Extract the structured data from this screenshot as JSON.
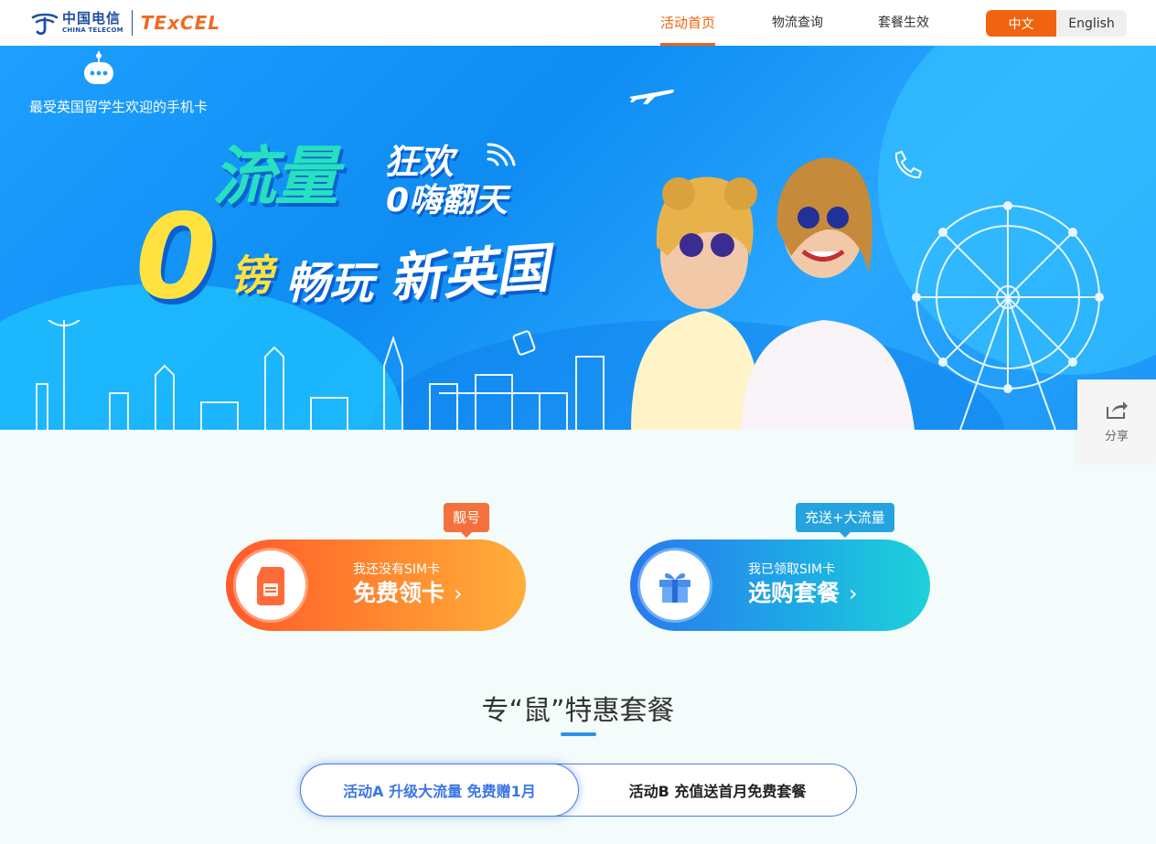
{
  "header": {
    "logo": {
      "cn_name": "中国电信",
      "en_name": "CHINA TELECOM",
      "brand": "TExCEL"
    },
    "nav": [
      {
        "label": "活动首页",
        "active": true
      },
      {
        "label": "物流查询",
        "active": false
      },
      {
        "label": "套餐生效",
        "active": false
      }
    ],
    "lang": {
      "zh": "中文",
      "en": "English",
      "active": "中文"
    }
  },
  "banner": {
    "tagline": "最受英国留学生欢迎的手机卡",
    "headline": {
      "flow": "流量",
      "carnival": "狂欢",
      "fun": "0嗨翻天",
      "zero": "0",
      "pound": "镑",
      "play": "畅玩",
      "uk": "新英国"
    }
  },
  "share": {
    "label": "分享",
    "icon": "share-icon"
  },
  "cta": {
    "new_sim": {
      "badge": "靓号",
      "subtitle": "我还没有SIM卡",
      "title": "免费领卡",
      "icon": "sim-card-icon",
      "color": "#ff6a2a"
    },
    "have_sim": {
      "badge": "充送+大流量",
      "subtitle": "我已领取SIM卡",
      "title": "选购套餐",
      "icon": "gift-icon",
      "color": "#2a86ea"
    },
    "arrow": "›"
  },
  "section": {
    "title": "专“鼠”特惠套餐"
  },
  "tabs": [
    {
      "label": "活动A 升级大流量 免费赠1月",
      "active": true
    },
    {
      "label": "活动B 充值送首月免费套餐",
      "active": false
    }
  ],
  "colors": {
    "accent_orange": "#f0640f",
    "accent_blue": "#3b76e6",
    "banner_blue": "#1ea0ff"
  }
}
